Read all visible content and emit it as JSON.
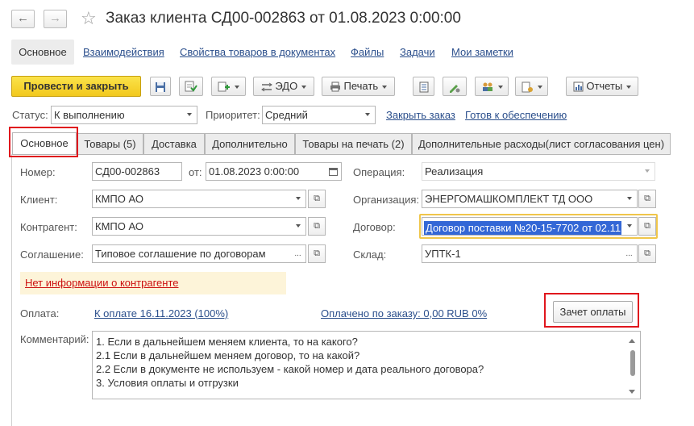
{
  "window": {
    "title": "Заказ клиента СД00-002863 от 01.08.2023 0:00:00"
  },
  "icons": [
    "back-arrow-icon",
    "forward-arrow-icon",
    "star-icon",
    "save-icon",
    "post-icon",
    "create-based-icon",
    "list-icon",
    "sign-icon",
    "users-icon",
    "doc-settings-icon",
    "reports-icon",
    "calendar-icon",
    "open-icon",
    "dropdown-icon"
  ],
  "sections": {
    "active": "Основное",
    "links": [
      "Взаимодействия",
      "Свойства товаров в документах",
      "Файлы",
      "Задачи",
      "Мои заметки"
    ]
  },
  "toolbar": {
    "post_close": "Провести и закрыть",
    "edo": "ЭДО",
    "print": "Печать",
    "reports": "Отчеты"
  },
  "status_bar": {
    "status_label": "Статус:",
    "status_value": "К выполнению",
    "priority_label": "Приоритет:",
    "priority_value": "Средний",
    "close_order": "Закрыть заказ",
    "ready": "Готов к обеспечению"
  },
  "tabs": [
    "Основное",
    "Товары (5)",
    "Доставка",
    "Дополнительно",
    "Товары на печать (2)",
    "Дополнительные расходы(лист согласования цен)"
  ],
  "form": {
    "number_label": "Номер:",
    "number_value": "СД00-002863",
    "from_label": "от:",
    "date_value": "01.08.2023  0:00:00",
    "operation_label": "Операция:",
    "operation_value": "Реализация",
    "client_label": "Клиент:",
    "client_value": "КМПО АО",
    "org_label": "Организация:",
    "org_value": "ЭНЕРГОМАШКОМПЛЕКТ ТД ООО",
    "counterparty_label": "Контрагент:",
    "counterparty_value": "КМПО АО",
    "contract_label": "Договор:",
    "contract_value": "Договор поставки №20-15-7702 от 02.11",
    "agreement_label": "Соглашение:",
    "agreement_value": "Типовое соглашение по договорам",
    "warehouse_label": "Склад:",
    "warehouse_value": "УПТК-1",
    "ellipsis": "...",
    "no_info": "Нет информации о контрагенте",
    "payment_label": "Оплата:",
    "payment_link": "К оплате 16.11.2023 (100%)",
    "paid_link": "Оплачено по заказу: 0,00 RUB 0%",
    "offset_button": "Зачет оплаты",
    "comment_label": "Комментарий:",
    "comment_lines": [
      "1. Если в дальнейшем меняем клиента, то на какого?",
      "2.1 Если в дальнейшем меняем договор, то на какой?",
      "2.2 Если в документе не используем - какой номер и дата реального договора?",
      "3. Условия оплаты и отгрузки"
    ]
  },
  "colors": {
    "accent_yellow": "#f2c81d",
    "link_blue": "#2b4f8c",
    "highlight_red": "#e0161d",
    "warning_bg": "#fdf4d9",
    "selection_blue": "#3367d6"
  }
}
